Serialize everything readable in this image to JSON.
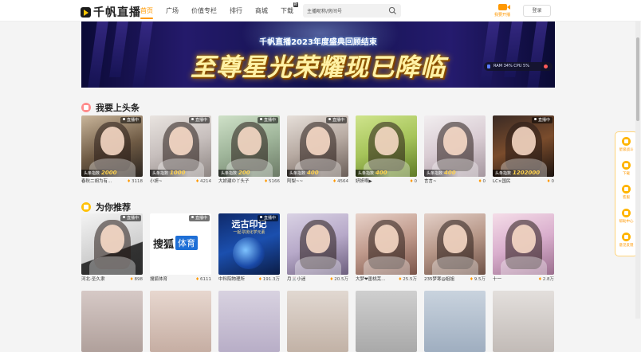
{
  "header": {
    "logo_text": "千帆直播",
    "nav": [
      {
        "label": "首页",
        "active": true
      },
      {
        "label": "广场",
        "active": false
      },
      {
        "label": "价值专栏",
        "active": false
      },
      {
        "label": "排行",
        "active": false
      },
      {
        "label": "商城",
        "active": false
      },
      {
        "label": "下载",
        "active": false,
        "badge": "新"
      }
    ],
    "search": {
      "value": "主播昵称/房间号",
      "icon": "search-icon"
    },
    "live_start_label": "我要开播",
    "login_label": "登录"
  },
  "banner": {
    "subtitle": "千帆直播2023年度盛典回顾结束",
    "title": "至尊星光荣耀现已降临",
    "stats": "RAM 34%  CPU 5%"
  },
  "sections": {
    "headline": {
      "title": "我要上头条",
      "icon": "crown-icon",
      "rank_prefix": "头条指数",
      "live_tag": "直播中",
      "cards": [
        {
          "name": "春秋二胡为有…",
          "count": "3118",
          "rank": "2000",
          "live": true
        },
        {
          "name": "小妍~",
          "count": "4214",
          "rank": "1000",
          "live": true
        },
        {
          "name": "大娇建の丫头子",
          "count": "5166",
          "rank": "200",
          "live": true
        },
        {
          "name": "阿梨~~",
          "count": "4564",
          "rank": "400",
          "live": true
        },
        {
          "name": "妍妍啊▶",
          "count": "0",
          "rank": "400",
          "live": false
        },
        {
          "name": "言言~",
          "count": "0",
          "rank": "400",
          "live": false
        },
        {
          "name": "LC×国民",
          "count": "0",
          "rank": "1202000",
          "live": true
        }
      ]
    },
    "recommend": {
      "title": "为你推荐",
      "icon": "flame-icon",
      "live_tag": "直播中",
      "cards": [
        {
          "name": "河北-圣久隶",
          "count": "898",
          "live": true
        },
        {
          "name": "搜狐体育",
          "count": "6111",
          "live": true
        },
        {
          "name": "中科院物理所",
          "count": "191.3万",
          "live": true
        },
        {
          "name": "月🐰小迷",
          "count": "20.5万",
          "live": false
        },
        {
          "name": "大梦❤墨桃芜…",
          "count": "25.5万",
          "live": false
        },
        {
          "name": "235梦寒@姐姐",
          "count": "9.5万",
          "live": false
        },
        {
          "name": "十一",
          "count": "2.8万",
          "live": false
        }
      ],
      "thumb_texts": {
        "sohu": "搜狐",
        "sohu_tag": "体育",
        "science": "远古印记",
        "science_sub": "一起寻找化学元素"
      }
    }
  },
  "sidebar": {
    "items": [
      {
        "label": "星级战斗",
        "icon": "star-icon"
      },
      {
        "label": "下载",
        "icon": "download-icon"
      },
      {
        "label": "客服",
        "icon": "chat-icon"
      },
      {
        "label": "帮助中心",
        "icon": "help-icon"
      },
      {
        "label": "意见反馈",
        "icon": "feedback-icon"
      }
    ]
  },
  "colors": {
    "accent": "#ff9800",
    "gold": "#ffd24d"
  }
}
